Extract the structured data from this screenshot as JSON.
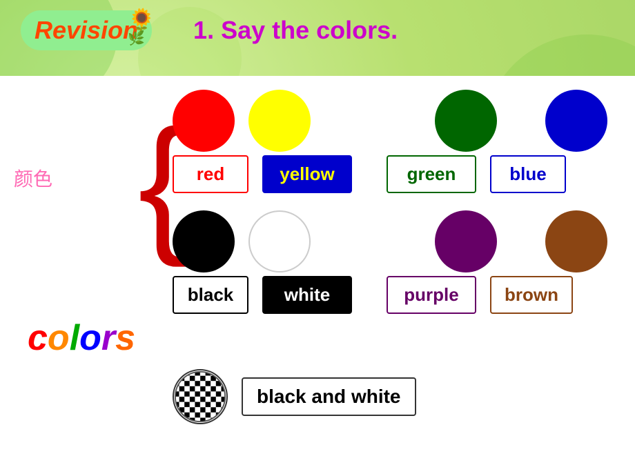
{
  "header": {
    "revision_label": "Revision",
    "sunflower": "🌻",
    "leaf": "🌿",
    "title": "1. Say the colors."
  },
  "colors_word": {
    "letters": [
      "c",
      "o",
      "l",
      "o",
      "r",
      "s"
    ],
    "chinese": "颜色"
  },
  "brace": "{",
  "rows": {
    "circles_top": [
      {
        "color": "red",
        "label": "red"
      },
      {
        "color": "yellow",
        "label": "yellow"
      },
      {
        "color": "green",
        "label": "green"
      },
      {
        "color": "blue",
        "label": "blue"
      }
    ],
    "circles_bottom": [
      {
        "color": "black",
        "label": "black"
      },
      {
        "color": "white",
        "label": "white"
      },
      {
        "color": "purple",
        "label": "purple"
      },
      {
        "color": "brown",
        "label": "brown"
      }
    ]
  },
  "baw": {
    "label": "black  and  white"
  }
}
